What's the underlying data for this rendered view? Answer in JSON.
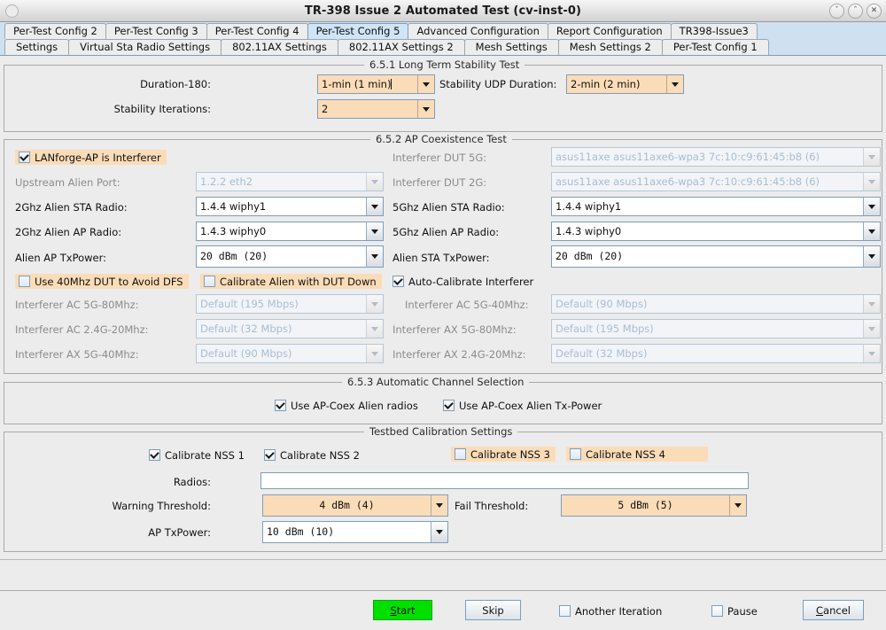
{
  "window": {
    "title": "TR-398 Issue 2 Automated Test  (cv-inst-0)",
    "minimize": "ˇ",
    "maximize": "ˆ",
    "close": "✕"
  },
  "tabs_row1": [
    {
      "label": "Per-Test Config 2",
      "selected": false
    },
    {
      "label": "Per-Test Config 3",
      "selected": false
    },
    {
      "label": "Per-Test Config 4",
      "selected": false
    },
    {
      "label": "Per-Test Config 5",
      "selected": true
    },
    {
      "label": "Advanced Configuration",
      "selected": false
    },
    {
      "label": "Report Configuration",
      "selected": false
    },
    {
      "label": "TR398-Issue3",
      "selected": false
    }
  ],
  "tabs_row2": [
    {
      "label": "Settings",
      "selected": false
    },
    {
      "label": "Virtual Sta Radio Settings",
      "selected": false
    },
    {
      "label": "802.11AX Settings",
      "selected": false
    },
    {
      "label": "802.11AX Settings 2",
      "selected": false
    },
    {
      "label": "Mesh Settings",
      "selected": false
    },
    {
      "label": "Mesh Settings 2",
      "selected": false
    },
    {
      "label": "Per-Test Config 1",
      "selected": false
    }
  ],
  "stability": {
    "legend": "6.5.1 Long Term Stability Test",
    "duration_label": "Duration-180:",
    "duration_value": "1-min (1 min)",
    "udp_label": "Stability UDP Duration:",
    "udp_value": "2-min (2 min)",
    "iterations_label": "Stability Iterations:",
    "iterations_value": "2"
  },
  "coex": {
    "legend": "6.5.2 AP Coexistence Test",
    "lanforge_interferer_label": "LANforge-AP is Interferer",
    "lanforge_interferer_checked": true,
    "upstream_alien_port_label": "Upstream Alien Port:",
    "upstream_alien_port_value": "1.2.2 eth2",
    "interferer_dut_5g_label": "Interferer DUT 5G:",
    "interferer_dut_5g_value": "asus11axe asus11axe6-wpa3 7c:10:c9:61:45:b8 (6)",
    "interferer_dut_2g_label": "Interferer DUT 2G:",
    "interferer_dut_2g_value": "asus11axe asus11axe6-wpa3 7c:10:c9:61:45:b8 (6)",
    "sta2_label": "2Ghz Alien STA Radio:",
    "sta2_value": "1.4.4 wiphy1",
    "sta5_label": "5Ghz Alien STA Radio:",
    "sta5_value": "1.4.4 wiphy1",
    "ap2_label": "2Ghz Alien AP Radio:",
    "ap2_value": "1.4.3 wiphy0",
    "ap5_label": "5Ghz Alien AP Radio:",
    "ap5_value": "1.4.3 wiphy0",
    "ap_txpower_label": "Alien AP TxPower:",
    "ap_txpower_value": "20  dBm  (20)",
    "sta_txpower_label": "Alien STA TxPower:",
    "sta_txpower_value": "20  dBm  (20)",
    "use40_label": "Use 40Mhz DUT to Avoid DFS",
    "use40_checked": false,
    "calib_alien_label": "Calibrate Alien with DUT Down",
    "calib_alien_checked": false,
    "autocal_label": "Auto-Calibrate Interferer",
    "autocal_checked": true,
    "rates": [
      {
        "label": "Interferer AC 5G-80Mhz:",
        "value": "Default (195 Mbps)"
      },
      {
        "label": "Interferer AC 5G-40Mhz:",
        "value": "Default (90 Mbps)"
      },
      {
        "label": "Interferer AC 2.4G-20Mhz:",
        "value": "Default (32 Mbps)"
      },
      {
        "label": "Interferer AX 5G-80Mhz:",
        "value": "Default (195 Mbps)"
      },
      {
        "label": "Interferer AX 5G-40Mhz:",
        "value": "Default (90 Mbps)"
      },
      {
        "label": "Interferer AX 2.4G-20Mhz:",
        "value": "Default (32 Mbps)"
      }
    ]
  },
  "acs": {
    "legend": "6.5.3 Automatic Channel Selection",
    "radios_label": "Use AP-Coex Alien radios",
    "radios_checked": true,
    "txpower_label": "Use AP-Coex Alien Tx-Power",
    "txpower_checked": true
  },
  "calib": {
    "legend": "Testbed Calibration Settings",
    "nss": [
      {
        "label": "Calibrate NSS 1",
        "checked": true,
        "highlight": false
      },
      {
        "label": "Calibrate NSS 2",
        "checked": true,
        "highlight": false
      },
      {
        "label": "Calibrate NSS 3",
        "checked": false,
        "highlight": true
      },
      {
        "label": "Calibrate NSS 4",
        "checked": false,
        "highlight": true
      }
    ],
    "radios_label": "Radios:",
    "radios_value": "",
    "warn_label": "Warning Threshold:",
    "warn_value": "4  dBm  (4)",
    "fail_label": "Fail Threshold:",
    "fail_value": "5  dBm  (5)",
    "ap_txpower_label": "AP TxPower:",
    "ap_txpower_value": "10  dBm  (10)"
  },
  "footer": {
    "start": "Start",
    "start_mn": "S",
    "skip": "Skip",
    "another_label": "Another Iteration",
    "another_checked": false,
    "pause_label": "Pause",
    "pause_checked": false,
    "cancel": "Cancel",
    "cancel_mn": "C"
  },
  "colors": {
    "highlight": "#fbdcb8",
    "start_green": "#00e000",
    "tab_selected": "#cfe5f7",
    "panel": "#ececec"
  }
}
